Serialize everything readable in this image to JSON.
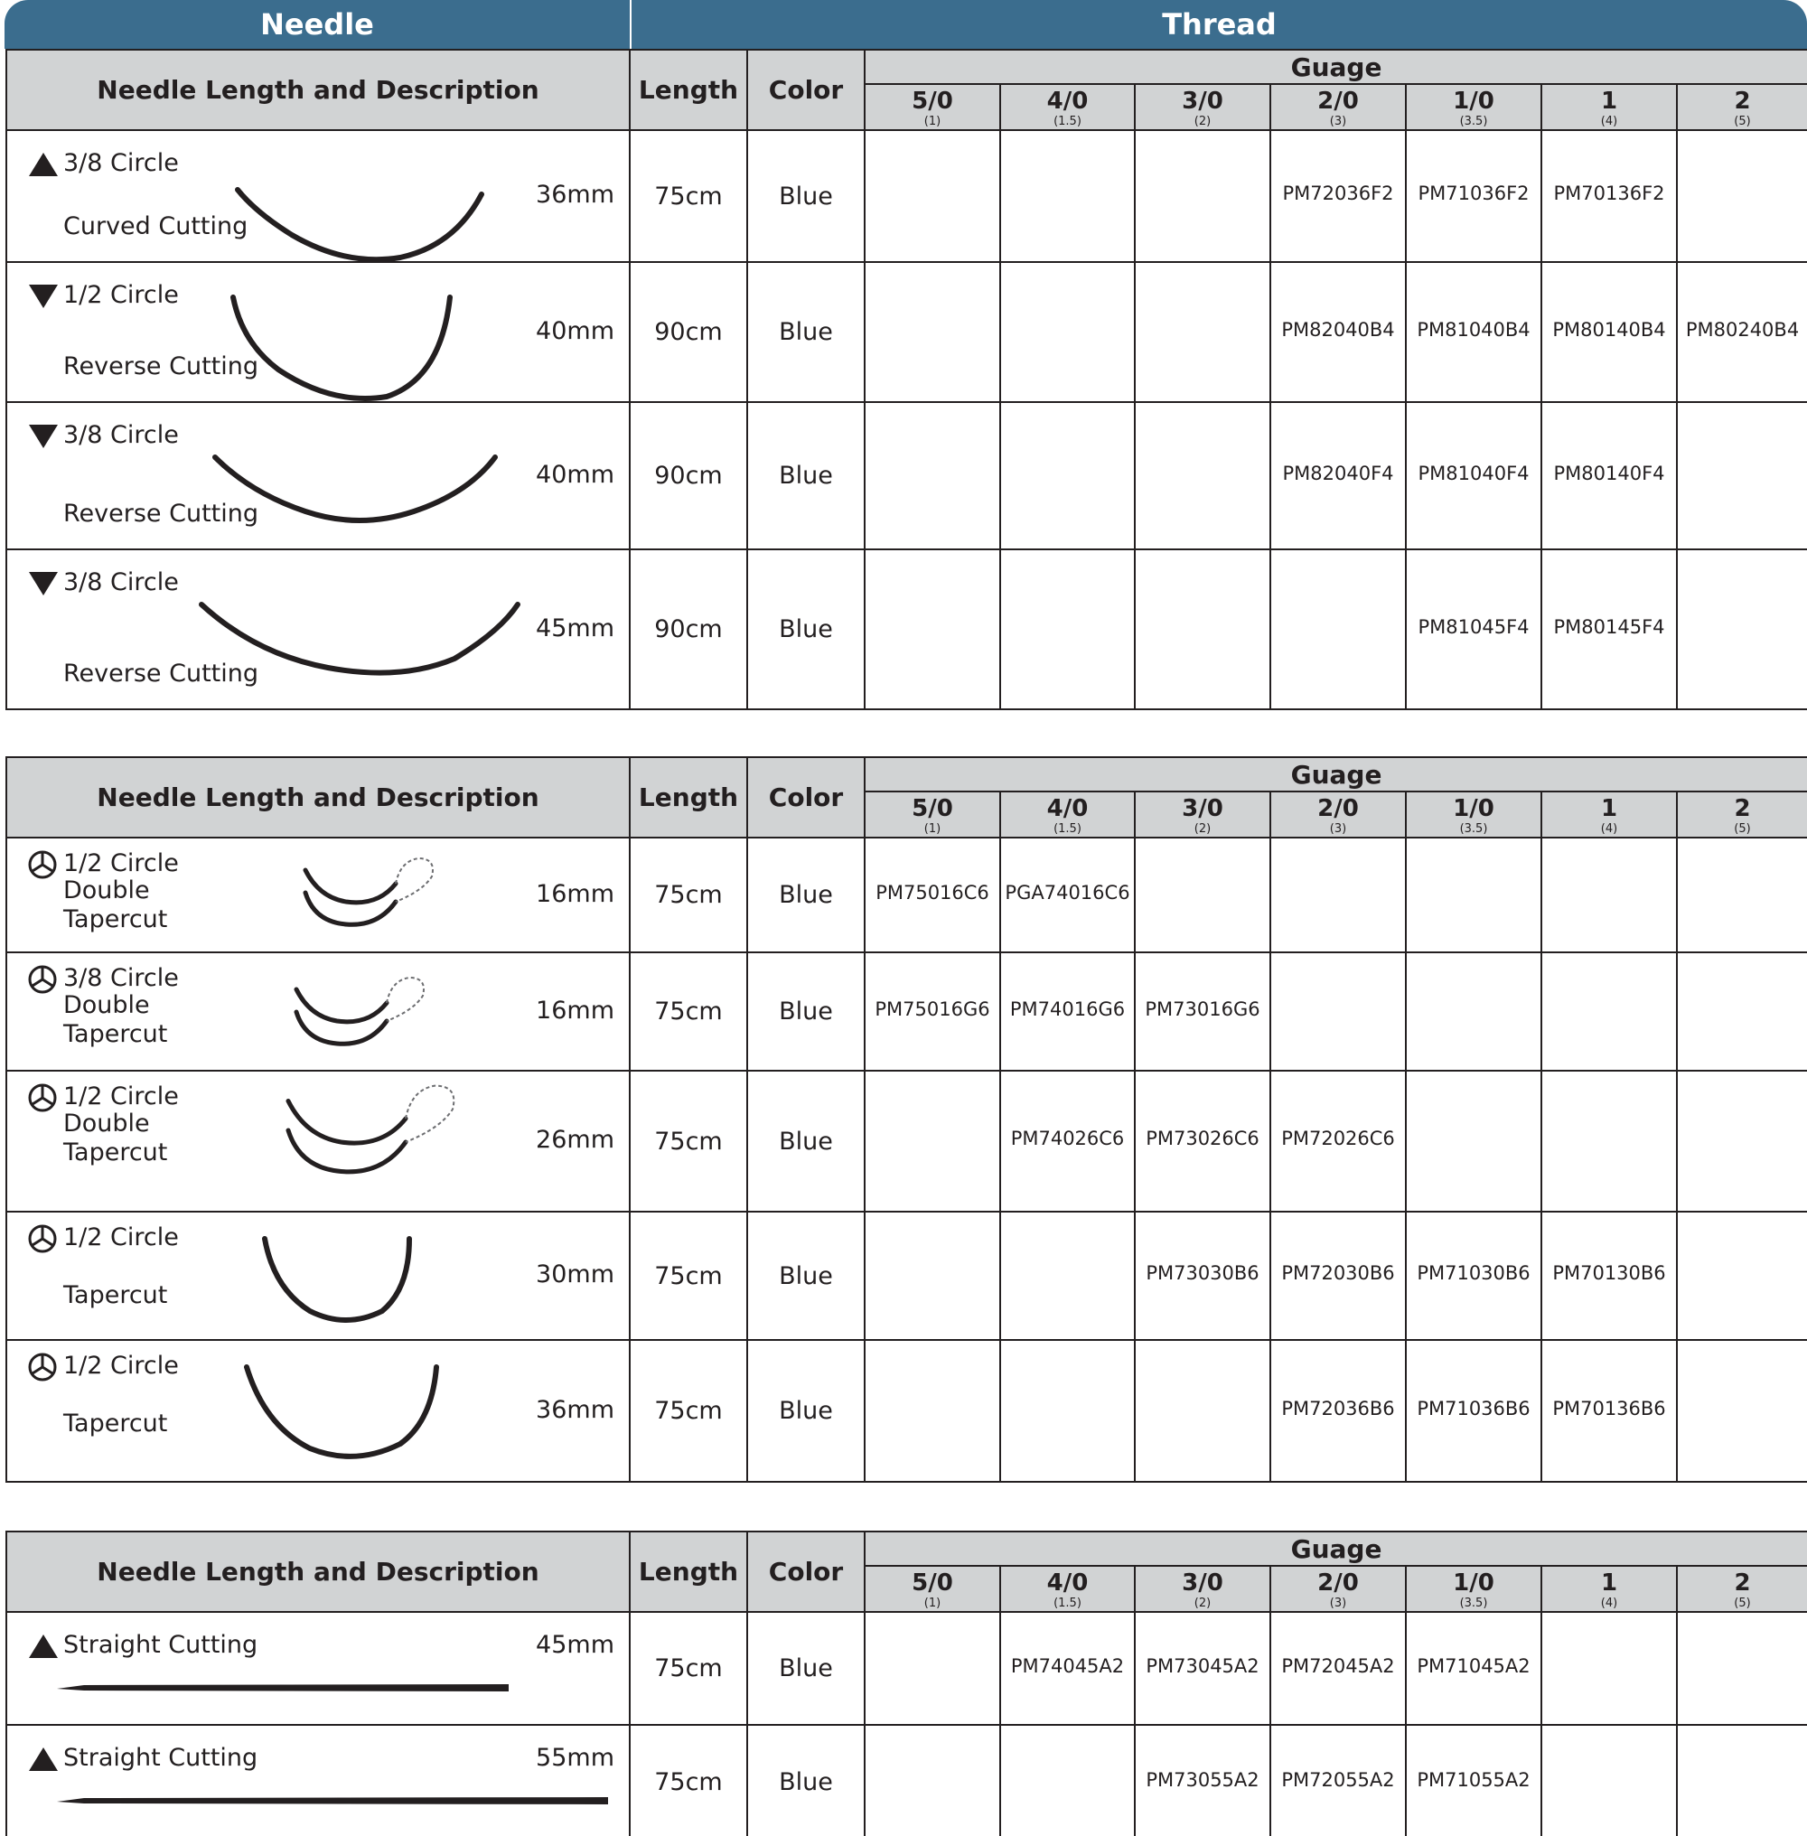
{
  "header": {
    "needle": "Needle",
    "thread": "Thread"
  },
  "columns": {
    "desc": "Needle Length and Description",
    "length": "Length",
    "color": "Color",
    "guage": "Guage",
    "gauges": [
      {
        "size": "5/0",
        "metric": "(1)"
      },
      {
        "size": "4/0",
        "metric": "(1.5)"
      },
      {
        "size": "3/0",
        "metric": "(2)"
      },
      {
        "size": "2/0",
        "metric": "(3)"
      },
      {
        "size": "1/0",
        "metric": "(3.5)"
      },
      {
        "size": "1",
        "metric": "(4)"
      },
      {
        "size": "2",
        "metric": "(5)"
      }
    ]
  },
  "sections": [
    {
      "rows": [
        {
          "icon": "triangle-up-icon",
          "line1": "3/8 Circle",
          "line2": "Curved Cutting",
          "line3": "",
          "needle": "36mm",
          "length": "75cm",
          "color": "Blue",
          "codes": [
            "",
            "",
            "",
            "PM72036F2",
            "PM71036F2",
            "PM70136F2",
            ""
          ]
        },
        {
          "icon": "triangle-down-icon",
          "line1": "1/2 Circle",
          "line2": "Reverse Cutting",
          "line3": "",
          "needle": "40mm",
          "length": "90cm",
          "color": "Blue",
          "codes": [
            "",
            "",
            "",
            "PM82040B4",
            "PM81040B4",
            "PM80140B4",
            "PM80240B4"
          ]
        },
        {
          "icon": "triangle-down-icon",
          "line1": "3/8 Circle",
          "line2": "Reverse Cutting",
          "line3": "",
          "needle": "40mm",
          "length": "90cm",
          "color": "Blue",
          "codes": [
            "",
            "",
            "",
            "PM82040F4",
            "PM81040F4",
            "PM80140F4",
            ""
          ]
        },
        {
          "icon": "triangle-down-icon",
          "line1": "3/8 Circle",
          "line2": "Reverse Cutting",
          "line3": "",
          "needle": "45mm",
          "length": "90cm",
          "color": "Blue",
          "codes": [
            "",
            "",
            "",
            "",
            "PM81045F4",
            "PM80145F4",
            ""
          ]
        }
      ]
    },
    {
      "rows": [
        {
          "icon": "taper-circle-icon",
          "line1": "1/2 Circle",
          "line2": "Double",
          "line3": "Tapercut",
          "needle": "16mm",
          "length": "75cm",
          "color": "Blue",
          "codes": [
            "PM75016C6",
            "PGA74016C6",
            "",
            "",
            "",
            "",
            ""
          ]
        },
        {
          "icon": "taper-circle-icon",
          "line1": "3/8 Circle",
          "line2": "Double",
          "line3": "Tapercut",
          "needle": "16mm",
          "length": "75cm",
          "color": "Blue",
          "codes": [
            "PM75016G6",
            "PM74016G6",
            "PM73016G6",
            "",
            "",
            "",
            ""
          ]
        },
        {
          "icon": "taper-circle-icon",
          "line1": "1/2 Circle",
          "line2": "Double",
          "line3": "Tapercut",
          "needle": "26mm",
          "length": "75cm",
          "color": "Blue",
          "codes": [
            "",
            "PM74026C6",
            "PM73026C6",
            "PM72026C6",
            "",
            "",
            ""
          ]
        },
        {
          "icon": "taper-circle-icon",
          "line1": "1/2 Circle",
          "line2": "Tapercut",
          "line3": "",
          "needle": "30mm",
          "length": "75cm",
          "color": "Blue",
          "codes": [
            "",
            "",
            "PM73030B6",
            "PM72030B6",
            "PM71030B6",
            "PM70130B6",
            ""
          ]
        },
        {
          "icon": "taper-circle-icon",
          "line1": "1/2 Circle",
          "line2": "Tapercut",
          "line3": "",
          "needle": "36mm",
          "length": "75cm",
          "color": "Blue",
          "codes": [
            "",
            "",
            "",
            "PM72036B6",
            "PM71036B6",
            "PM70136B6",
            ""
          ]
        }
      ]
    },
    {
      "rows": [
        {
          "icon": "triangle-up-icon",
          "line1": "Straight Cutting",
          "line2": "",
          "line3": "",
          "needle": "45mm",
          "length": "75cm",
          "color": "Blue",
          "codes": [
            "",
            "PM74045A2",
            "PM73045A2",
            "PM72045A2",
            "PM71045A2",
            "",
            ""
          ]
        },
        {
          "icon": "triangle-up-icon",
          "line1": "Straight Cutting",
          "line2": "",
          "line3": "",
          "needle": "55mm",
          "length": "75cm",
          "color": "Blue",
          "codes": [
            "",
            "",
            "PM73055A2",
            "PM72055A2",
            "PM71055A2",
            "",
            ""
          ]
        }
      ]
    }
  ]
}
